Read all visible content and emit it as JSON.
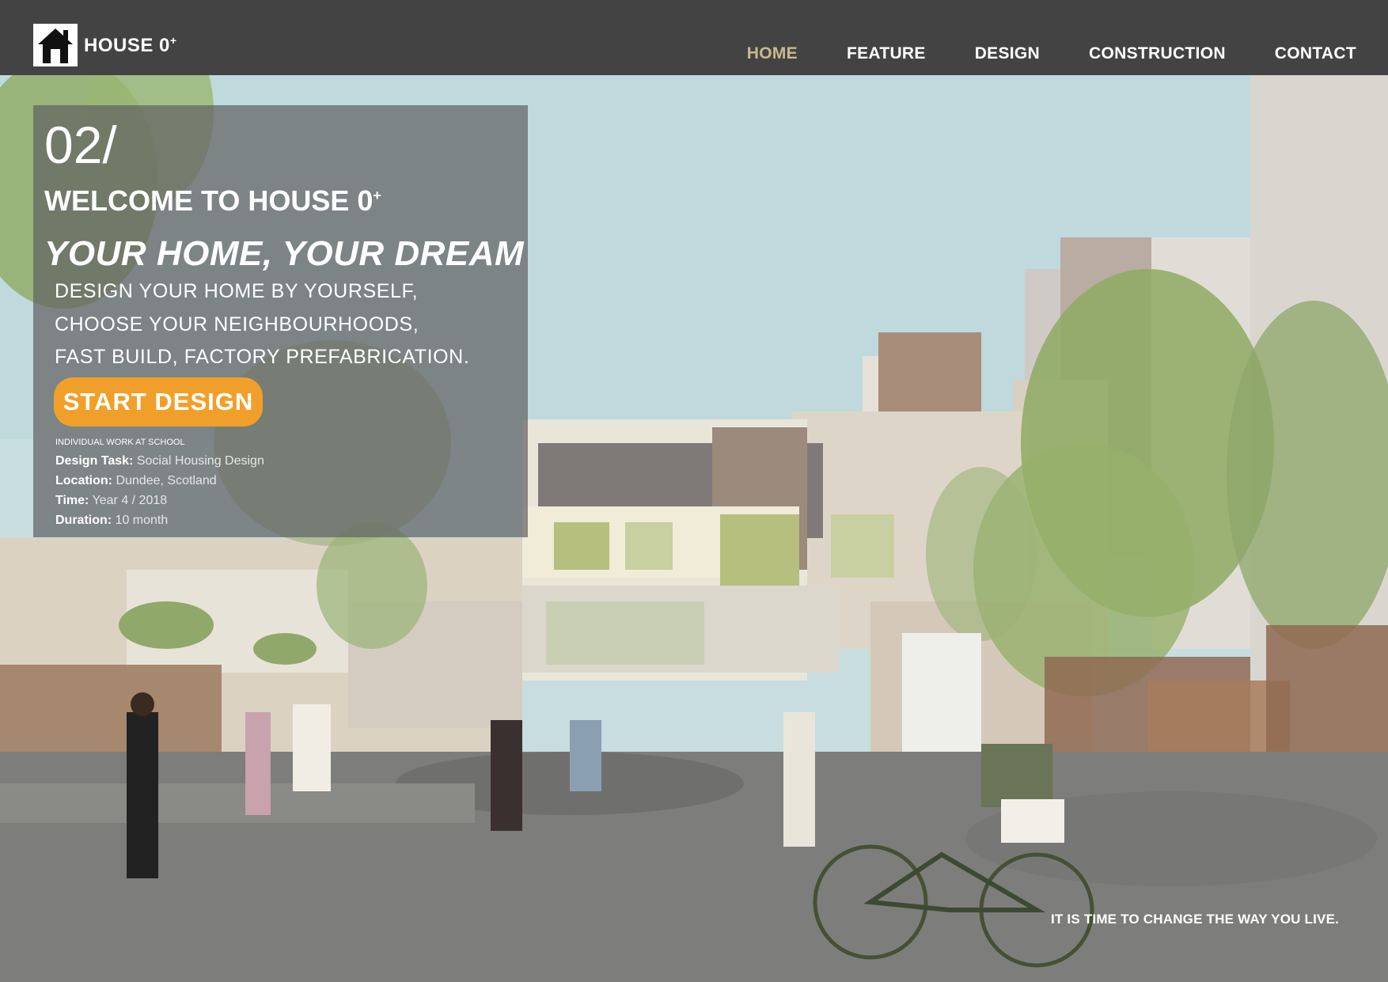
{
  "brand": {
    "name": "HOUSE 0",
    "superscript": "+"
  },
  "nav": [
    {
      "label": "HOME",
      "active": true
    },
    {
      "label": "FEATURE",
      "active": false
    },
    {
      "label": "DESIGN",
      "active": false
    },
    {
      "label": "CONSTRUCTION",
      "active": false
    },
    {
      "label": "CONTACT",
      "active": false
    }
  ],
  "hero": {
    "number": "02/",
    "welcome": "WELCOME TO HOUSE 0",
    "welcome_sup": "+",
    "headline": "YOUR HOME, YOUR DREAM",
    "lines": [
      "DESIGN YOUR HOME BY YOURSELF,",
      "CHOOSE YOUR NEIGHBOURHOODS,",
      "FAST BUILD, FACTORY PREFABRICATION."
    ],
    "cta": "START DESIGN",
    "caption": "INDIVIDUAL WORK AT SCHOOL",
    "details": [
      {
        "label": "Design Task:",
        "value": "Social Housing Design"
      },
      {
        "label": "Location:",
        "value": "Dundee, Scotland"
      },
      {
        "label": "Time:",
        "value": "Year 4 / 2018"
      },
      {
        "label": "Duration:",
        "value": "10 month"
      }
    ]
  },
  "slogan": "IT IS TIME TO CHANGE THE WAY YOU LIVE.",
  "colors": {
    "header": "#434343",
    "active_nav": "#c9b98f",
    "cta": "#f0a02a"
  }
}
